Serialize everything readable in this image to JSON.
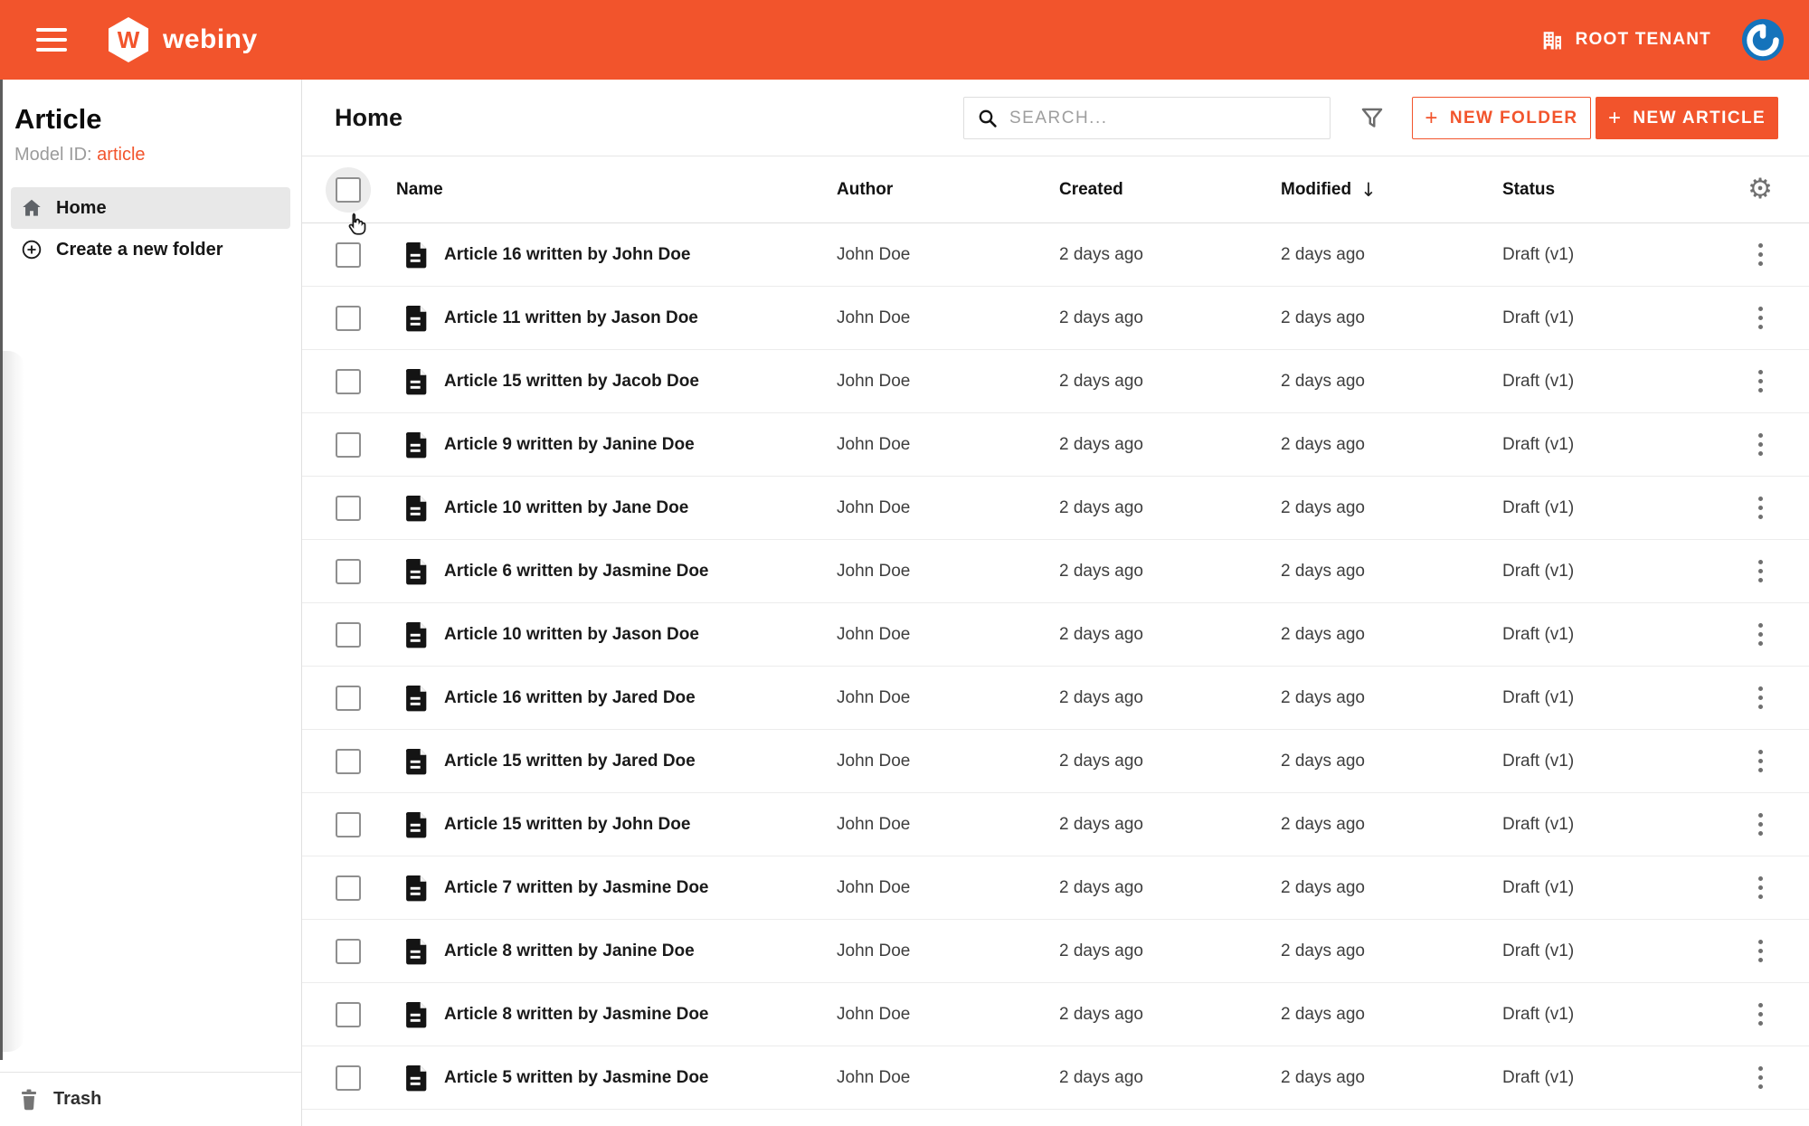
{
  "colors": {
    "orange": "#F2542C",
    "text-primary": "#181818",
    "text-secondary": "#3E3E3E",
    "muted": "#9B9B9B",
    "icon-gray": "#707070",
    "divider": "#ECECEC",
    "selected-bg": "#E8E8E8",
    "checkbox-border": "#8F8F8F",
    "avatar-blue": "#1573BB"
  },
  "appbar": {
    "logo_text": "webiny",
    "tenant_label": "ROOT TENANT"
  },
  "sidebar": {
    "title": "Article",
    "model_id_label": "Model ID:",
    "model_id_value": "article",
    "home_label": "Home",
    "create_folder_label": "Create a new folder",
    "trash_label": "Trash"
  },
  "main": {
    "title": "Home",
    "search_placeholder": "SEARCH...",
    "plus_glyph": "+",
    "new_folder_label": "NEW FOLDER",
    "new_article_label": "NEW ARTICLE"
  },
  "icons": {
    "gear_glyph": "⚙",
    "sort_down_glyph": "↓"
  },
  "table": {
    "columns": {
      "name": "Name",
      "author": "Author",
      "created": "Created",
      "modified": "Modified",
      "status": "Status"
    },
    "sorted_column": "Modified",
    "rows": [
      {
        "name": "Article 16 written by John Doe",
        "author": "John Doe",
        "created": "2 days ago",
        "modified": "2 days ago",
        "status": "Draft (v1)"
      },
      {
        "name": "Article 11 written by Jason Doe",
        "author": "John Doe",
        "created": "2 days ago",
        "modified": "2 days ago",
        "status": "Draft (v1)"
      },
      {
        "name": "Article 15 written by Jacob Doe",
        "author": "John Doe",
        "created": "2 days ago",
        "modified": "2 days ago",
        "status": "Draft (v1)"
      },
      {
        "name": "Article 9 written by Janine Doe",
        "author": "John Doe",
        "created": "2 days ago",
        "modified": "2 days ago",
        "status": "Draft (v1)"
      },
      {
        "name": "Article 10 written by Jane Doe",
        "author": "John Doe",
        "created": "2 days ago",
        "modified": "2 days ago",
        "status": "Draft (v1)"
      },
      {
        "name": "Article 6 written by Jasmine Doe",
        "author": "John Doe",
        "created": "2 days ago",
        "modified": "2 days ago",
        "status": "Draft (v1)"
      },
      {
        "name": "Article 10 written by Jason Doe",
        "author": "John Doe",
        "created": "2 days ago",
        "modified": "2 days ago",
        "status": "Draft (v1)"
      },
      {
        "name": "Article 16 written by Jared Doe",
        "author": "John Doe",
        "created": "2 days ago",
        "modified": "2 days ago",
        "status": "Draft (v1)"
      },
      {
        "name": "Article 15 written by Jared Doe",
        "author": "John Doe",
        "created": "2 days ago",
        "modified": "2 days ago",
        "status": "Draft (v1)"
      },
      {
        "name": "Article 15 written by John Doe",
        "author": "John Doe",
        "created": "2 days ago",
        "modified": "2 days ago",
        "status": "Draft (v1)"
      },
      {
        "name": "Article 7 written by Jasmine Doe",
        "author": "John Doe",
        "created": "2 days ago",
        "modified": "2 days ago",
        "status": "Draft (v1)"
      },
      {
        "name": "Article 8 written by Janine Doe",
        "author": "John Doe",
        "created": "2 days ago",
        "modified": "2 days ago",
        "status": "Draft (v1)"
      },
      {
        "name": "Article 8 written by Jasmine Doe",
        "author": "John Doe",
        "created": "2 days ago",
        "modified": "2 days ago",
        "status": "Draft (v1)"
      },
      {
        "name": "Article 5 written by Jasmine Doe",
        "author": "John Doe",
        "created": "2 days ago",
        "modified": "2 days ago",
        "status": "Draft (v1)"
      }
    ]
  }
}
